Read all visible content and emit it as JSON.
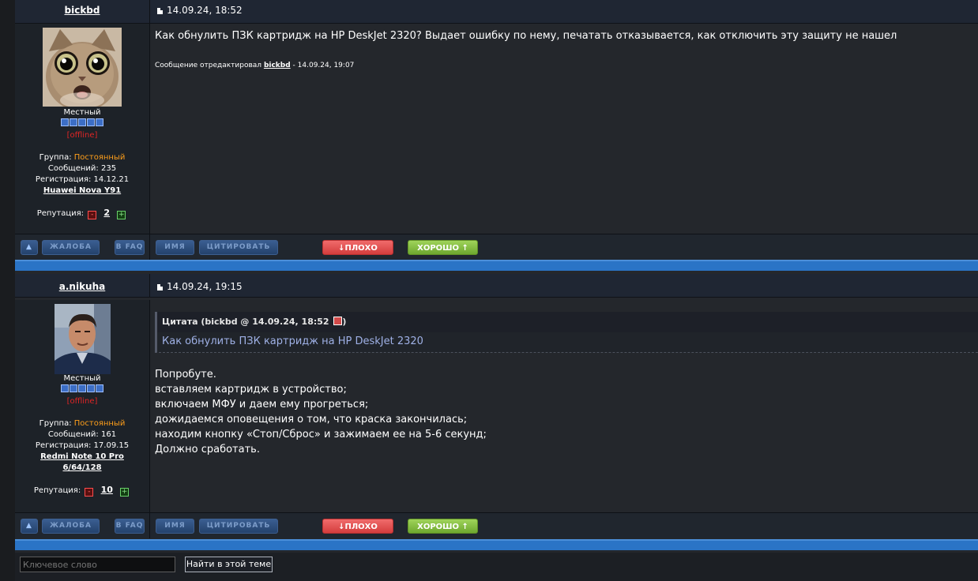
{
  "posts": [
    {
      "author": "bickbd",
      "date": "14.09.24, 18:52",
      "rank": "Местный",
      "status": "[offline]",
      "group_label": "Группа:",
      "group_value": "Постоянный",
      "messages_label": "Сообщений:",
      "messages_value": "235",
      "registration_label": "Регистрация:",
      "registration_value": "14.12.21",
      "device_line1": "Huawei Nova Y91",
      "device_line2": "",
      "reputation_label": "Репутация:",
      "reputation_value": "2",
      "message": "Как обнулить ПЗК картридж на HP DeskJet 2320? Выдает ошибку по нему, печатать отказывается, как отключить эту защиту не нашел",
      "edit_prefix": "Сообщение отредактировал",
      "edit_user": "bickbd",
      "edit_suffix": "- 14.09.24, 19:07"
    },
    {
      "author": "a.nikuha",
      "date": "14.09.24, 19:15",
      "rank": "Местный",
      "status": "[offline]",
      "group_label": "Группа:",
      "group_value": "Постоянный",
      "messages_label": "Сообщений:",
      "messages_value": "161",
      "registration_label": "Регистрация:",
      "registration_value": "17.09.15",
      "device_line1": "Redmi Note 10 Pro",
      "device_line2": "6/64/128",
      "reputation_label": "Репутация:",
      "reputation_value": "10",
      "quote_title": "Цитата (bickbd @ 14.09.24, 18:52",
      "quote_close": ")",
      "quote_text": "Как обнулить ПЗК картридж на HP DeskJet 2320",
      "message_lines": [
        "Попробуте.",
        "вставляем картридж в устройство;",
        "включаем МФУ и даем ему прогреться;",
        "дожидаемся оповещения о том, что краска закончилась;",
        "находим кнопку «Стоп/Сброс» и зажимаем ее на 5-6 секунд;",
        "Должно сработать."
      ]
    }
  ],
  "toolbar": {
    "complaint": "ЖАЛОБА",
    "faq": "В FAQ",
    "name": "ИМЯ",
    "quote": "ЦИТИРОВАТЬ",
    "bad": "ПЛОХО",
    "good": "ХОРОШО",
    "bad_icon": "↓",
    "good_icon": "↑"
  },
  "icons": {
    "rep_minus": "-",
    "rep_plus": "+"
  },
  "search": {
    "placeholder": "Ключевое слово",
    "button": "Найти в этой теме"
  }
}
